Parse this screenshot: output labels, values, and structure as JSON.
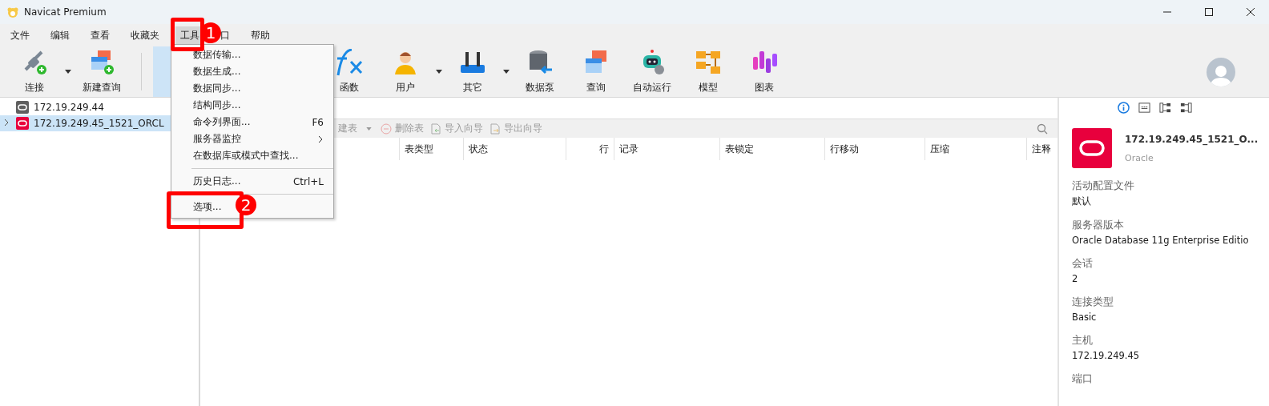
{
  "window": {
    "title": "Navicat Premium"
  },
  "menu_bar": [
    {
      "label": "文件",
      "selected": false
    },
    {
      "label": "编辑",
      "selected": false
    },
    {
      "label": "查看",
      "selected": false
    },
    {
      "label": "收藏夹",
      "selected": false
    },
    {
      "label": "工具",
      "selected": true
    },
    {
      "label": "口",
      "selected": false
    },
    {
      "label": "帮助",
      "selected": false
    }
  ],
  "toolbar": [
    {
      "kind": "connect",
      "label": "连接",
      "dropdown": true,
      "selected": false
    },
    {
      "kind": "new-query",
      "label": "新建查询",
      "dropdown": false,
      "selected": false
    },
    {
      "kind": "separator"
    },
    {
      "kind": "covered",
      "selected": true
    },
    {
      "kind": "function",
      "label": "函数",
      "dropdown": false,
      "selected": false
    },
    {
      "kind": "user",
      "label": "用户",
      "dropdown": true,
      "selected": false
    },
    {
      "kind": "tools",
      "label": "其它",
      "dropdown": true,
      "selected": false
    },
    {
      "kind": "pump",
      "label": "数据泵",
      "dropdown": false,
      "selected": false
    },
    {
      "kind": "query",
      "label": "查询",
      "dropdown": false,
      "selected": false
    },
    {
      "kind": "robot",
      "label": "自动运行",
      "dropdown": false,
      "selected": false
    },
    {
      "kind": "model",
      "label": "模型",
      "dropdown": false,
      "selected": false
    },
    {
      "kind": "chart",
      "label": "图表",
      "dropdown": false,
      "selected": false
    }
  ],
  "tree": [
    {
      "label": "172.19.249.44",
      "color": "#5f5f5f",
      "selected": false,
      "expandable": false
    },
    {
      "label": "172.19.249.45_1521_ORCL",
      "color": "#e8003d",
      "selected": true,
      "expandable": true
    }
  ],
  "object_toolbar": [
    {
      "kind": "new",
      "label": "建表",
      "dropdown": true,
      "disabled": true
    },
    {
      "kind": "delete",
      "label": "删除表",
      "dropdown": false,
      "disabled": true
    },
    {
      "kind": "import",
      "label": "导入向导",
      "dropdown": false,
      "disabled": true
    },
    {
      "kind": "export",
      "label": "导出向导",
      "dropdown": false,
      "disabled": true
    }
  ],
  "columns": [
    {
      "label": "表类型",
      "kind": "text"
    },
    {
      "label": "状态",
      "kind": "text"
    },
    {
      "label": "行",
      "kind": "number"
    },
    {
      "label": "记录",
      "kind": "text"
    },
    {
      "label": "表锁定",
      "kind": "text"
    },
    {
      "label": "行移动",
      "kind": "text"
    },
    {
      "label": "压缩",
      "kind": "text"
    },
    {
      "label": "注释",
      "kind": "text"
    }
  ],
  "info_panel": {
    "tabs": [
      {
        "kind": "info",
        "selected": true
      },
      {
        "kind": "ddl",
        "selected": false
      },
      {
        "kind": "deps-out",
        "selected": false
      },
      {
        "kind": "deps-in",
        "selected": false
      }
    ],
    "name": "172.19.249.45_1521_O...",
    "type": "Oracle",
    "fields": [
      {
        "label": "活动配置文件",
        "value": "默认"
      },
      {
        "label": "服务器版本",
        "value": "Oracle Database 11g Enterprise Editio"
      },
      {
        "label": "会话",
        "value": "2"
      },
      {
        "label": "连接类型",
        "value": "Basic"
      },
      {
        "label": "主机",
        "value": "172.19.249.45"
      },
      {
        "label": "端口"
      }
    ]
  },
  "tools_menu": [
    {
      "kind": "item",
      "label": "数据传输..."
    },
    {
      "kind": "item",
      "label": "数据生成..."
    },
    {
      "kind": "item",
      "label": "数据同步..."
    },
    {
      "kind": "item",
      "label": "结构同步..."
    },
    {
      "kind": "item",
      "label": "命令列界面...",
      "shortcut": "F6"
    },
    {
      "kind": "submenu",
      "label": "服务器监控"
    },
    {
      "kind": "item",
      "label": "在数据库或模式中查找..."
    },
    {
      "kind": "separator"
    },
    {
      "kind": "item",
      "label": "历史日志...",
      "shortcut": "Ctrl+L"
    },
    {
      "kind": "separator"
    },
    {
      "kind": "item",
      "label": "选项..."
    }
  ],
  "annotations": [
    {
      "number": "1"
    },
    {
      "number": "2"
    }
  ]
}
